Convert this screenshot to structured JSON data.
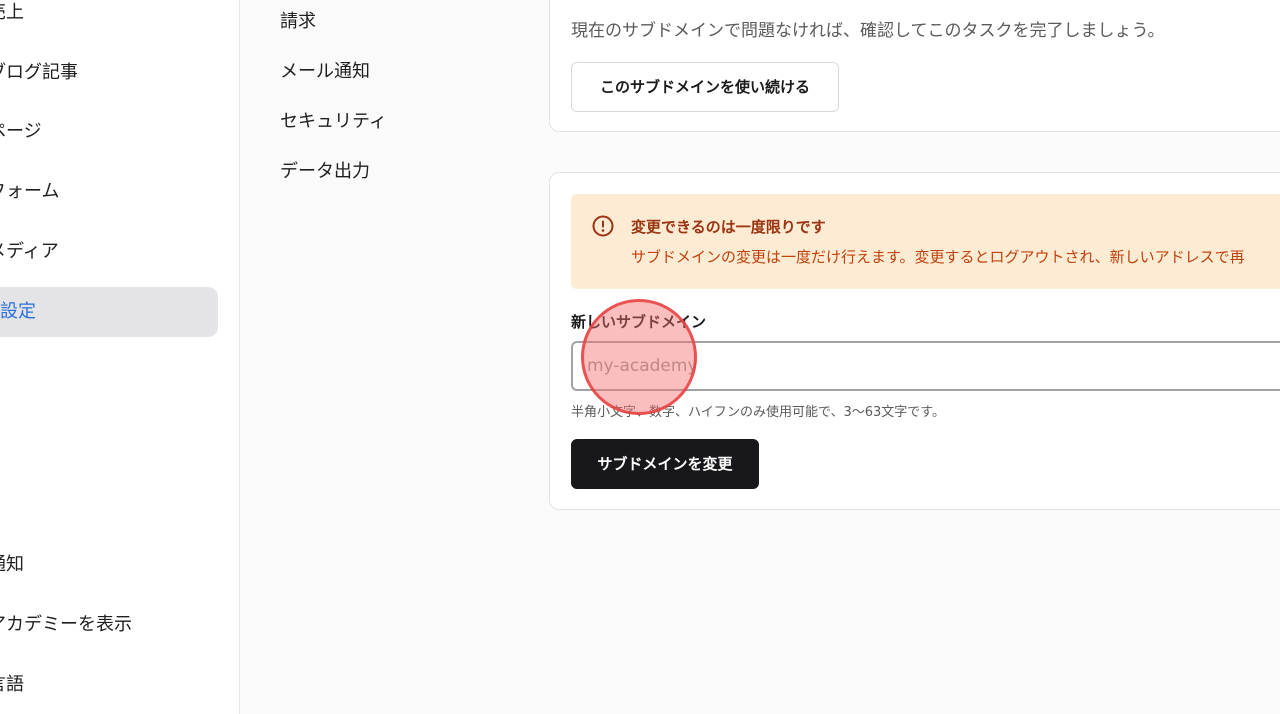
{
  "sidebar": {
    "items": [
      {
        "label": "売上"
      },
      {
        "label": "ブログ記事"
      },
      {
        "label": "ページ"
      },
      {
        "label": "フォーム"
      },
      {
        "label": "メディア"
      },
      {
        "label": "設定",
        "active": true
      }
    ],
    "bottom_items": [
      {
        "label": "通知"
      },
      {
        "label": "アカデミーを表示"
      },
      {
        "label": "言語"
      }
    ]
  },
  "settings_nav": {
    "items": [
      {
        "label": "請求"
      },
      {
        "label": "メール通知"
      },
      {
        "label": "セキュリティ"
      },
      {
        "label": "データ出力"
      }
    ]
  },
  "current_subdomain_card": {
    "description": "現在のサブドメインで問題なければ、確認してこのタスクを完了しましょう。",
    "keep_button_label": "このサブドメインを使い続ける"
  },
  "change_subdomain_card": {
    "alert": {
      "title": "変更できるのは一度限りです",
      "body": "サブドメインの変更は一度だけ行えます。変更するとログアウトされ、新しいアドレスで再"
    },
    "field_label": "新しいサブドメイン",
    "input_placeholder": "my-academy",
    "input_value": "",
    "hint": "半角小文字、数字、ハイフンのみ使用可能で、3〜63文字です。",
    "submit_label": "サブドメインを変更"
  },
  "colors": {
    "active_text": "#2a6fd8",
    "active_bg": "#e4e4e7",
    "alert_bg": "#fdebd3",
    "alert_title": "#9a3412",
    "alert_body": "#c2410c",
    "primary_button": "#18181b"
  },
  "icons": {
    "alert": "exclamation-circle-icon"
  }
}
